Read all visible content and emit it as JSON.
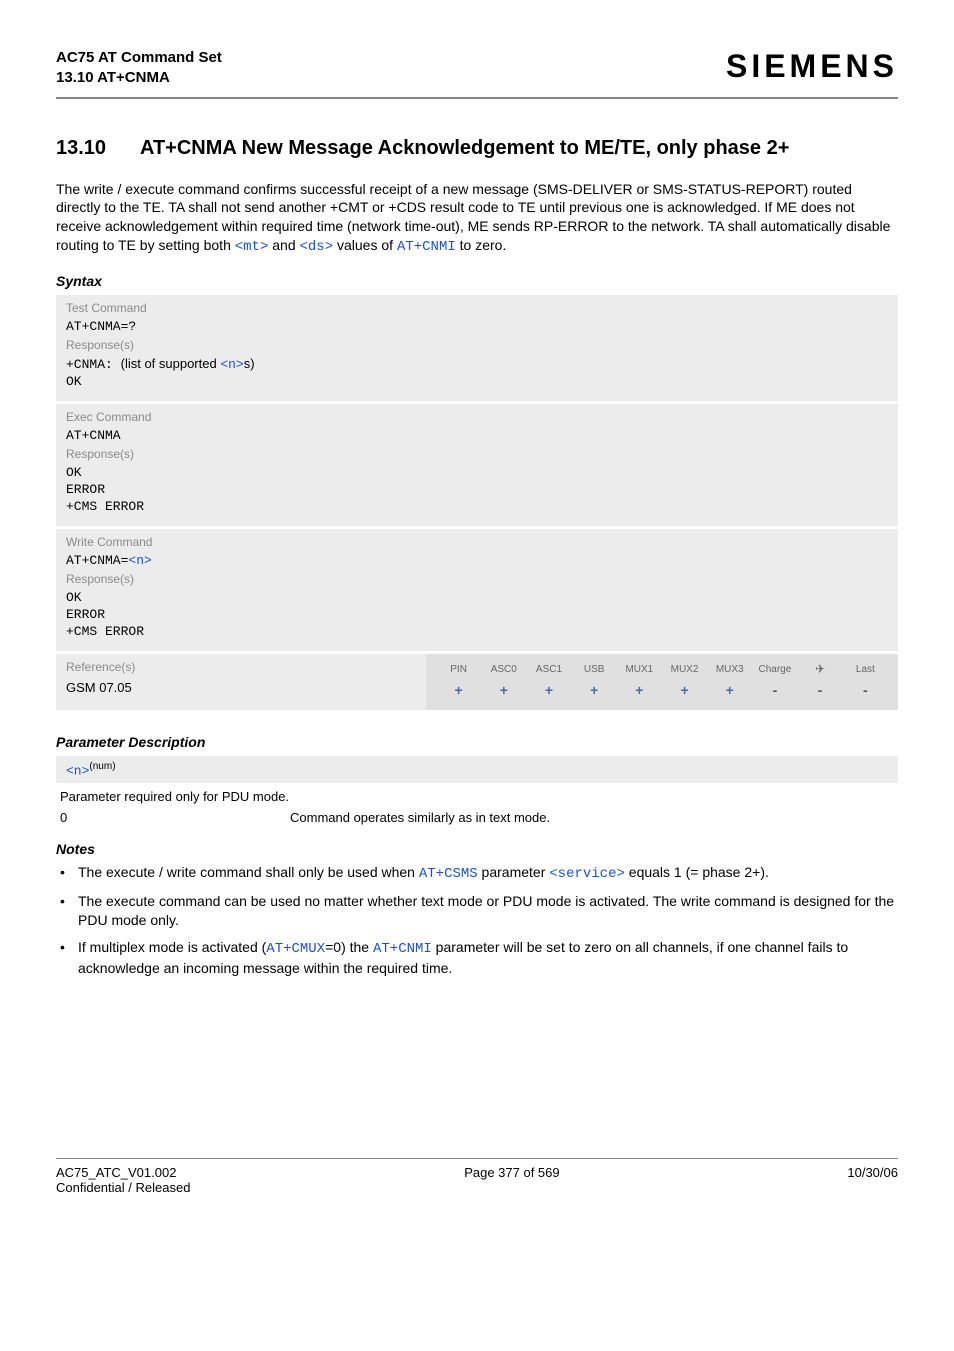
{
  "header": {
    "title_line1": "AC75 AT Command Set",
    "title_line2": "13.10 AT+CNMA",
    "brand": "SIEMENS"
  },
  "section": {
    "number": "13.10",
    "title": "AT+CNMA   New Message Acknowledgement to ME/TE, only phase 2+"
  },
  "intro": {
    "part1": "The write / execute command confirms successful receipt of a new message (SMS-DELIVER or SMS-STATUS-REPORT) routed directly to the TE. TA shall not send another +CMT or +CDS result code to TE until previous one is acknowledged. If ME does not receive acknowledgement within required time (network time-out), ME sends RP-ERROR to the network. TA shall automatically disable routing to TE by setting both ",
    "mt": "<mt>",
    "and": " and ",
    "ds": "<ds>",
    "part2": " values of ",
    "cnmi": "AT+CNMI",
    "part3": " to zero."
  },
  "syntax_label": "Syntax",
  "test": {
    "label": "Test Command",
    "cmd": "AT+CNMA=?",
    "resp_label": "Response(s)",
    "resp_prefix": "+CNMA: ",
    "resp_text": "(list of supported ",
    "n": "<n>",
    "resp_suffix": "s)",
    "ok": "OK"
  },
  "exec": {
    "label": "Exec Command",
    "cmd": "AT+CNMA",
    "resp_label": "Response(s)",
    "ok": "OK",
    "error": "ERROR",
    "cms": "+CMS ERROR"
  },
  "write": {
    "label": "Write Command",
    "cmd_prefix": "AT+CNMA=",
    "n": "<n>",
    "resp_label": "Response(s)",
    "ok": "OK",
    "error": "ERROR",
    "cms": "+CMS ERROR"
  },
  "ref": {
    "label": "Reference(s)",
    "value": "GSM 07.05",
    "cols": [
      "PIN",
      "ASC0",
      "ASC1",
      "USB",
      "MUX1",
      "MUX2",
      "MUX3",
      "Charge",
      "✈",
      "Last"
    ],
    "vals": [
      "+",
      "+",
      "+",
      "+",
      "+",
      "+",
      "+",
      "-",
      "-",
      "-"
    ]
  },
  "params": {
    "heading": "Parameter Description",
    "n_label": "<n>",
    "n_sup": "(num)",
    "n_desc": "Parameter required only for PDU mode.",
    "row_key": "0",
    "row_val": "Command operates similarly as in text mode."
  },
  "notes": {
    "heading": "Notes",
    "item1_a": "The execute / write command shall only be used when ",
    "item1_csms": "AT+CSMS",
    "item1_b": " parameter ",
    "item1_service": "<service>",
    "item1_c": " equals 1 (= phase 2+).",
    "item2": "The execute command can be used no matter whether text mode or PDU mode is activated. The write command is designed for the PDU mode only.",
    "item3_a": "If multiplex mode is activated (",
    "item3_cmux": "AT+CMUX",
    "item3_b": "=0) the ",
    "item3_cnmi": "AT+CNMI",
    "item3_c": " parameter will be set to zero on all channels, if one channel fails to acknowledge an incoming message within the required time."
  },
  "footer": {
    "left1": "AC75_ATC_V01.002",
    "left2": "Confidential / Released",
    "center": "Page 377 of 569",
    "right": "10/30/06"
  }
}
